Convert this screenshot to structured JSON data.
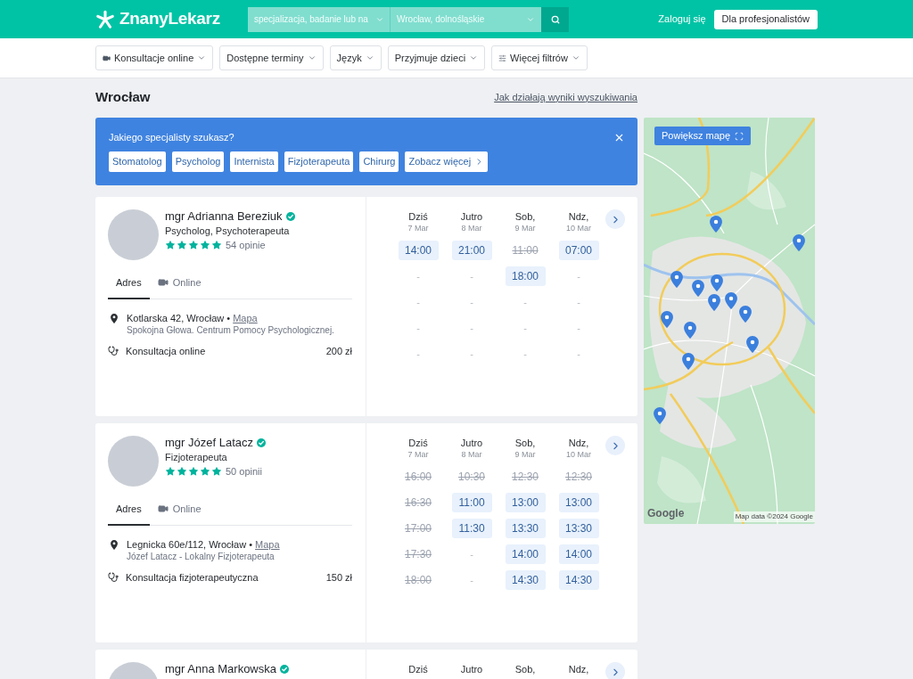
{
  "header": {
    "logo": "ZnanyLekarz",
    "search_fields": [
      {
        "placeholder": "specjalizacja, badanie lub na"
      },
      {
        "value": "Wrocław, dolnośląskie"
      }
    ],
    "login": "Zaloguj się",
    "pro_button": "Dla profesjonalistów"
  },
  "filters": [
    {
      "label": "Konsultacje online",
      "kind": "video"
    },
    {
      "label": "Dostępne terminy",
      "kind": "plain"
    },
    {
      "label": "Język",
      "kind": "plain"
    },
    {
      "label": "Przyjmuje dzieci",
      "kind": "plain"
    },
    {
      "label": "Więcej filtrów",
      "kind": "filter"
    }
  ],
  "results_header": {
    "title": "Wrocław",
    "help_link": "Jak działają wyniki wyszukiwania"
  },
  "specialist_prompt": {
    "title": "Jakiego specjalisty szukasz?",
    "chips": [
      {
        "label": "Stomatolog",
        "kind": "plain"
      },
      {
        "label": "Psycholog",
        "kind": "plain"
      },
      {
        "label": "Internista",
        "kind": "plain"
      },
      {
        "label": "Fizjoterapeuta",
        "kind": "plain"
      },
      {
        "label": "Chirurg",
        "kind": "plain"
      },
      {
        "label": "Zobacz więcej",
        "kind": "more"
      }
    ]
  },
  "doctors": [
    {
      "name": "mgr Adrianna Bereziuk",
      "verified": true,
      "specialties": "Psycholog, Psychoterapeuta",
      "stars": 5,
      "reviews": "54 opinie",
      "tabs": [
        {
          "label": "Adres",
          "kind": "plain",
          "selected": true
        },
        {
          "label": "Online",
          "kind": "video",
          "selected": false
        }
      ],
      "address": "Kotlarska 42, Wrocław •",
      "map_link": "Mapa",
      "clinic": "Spokojna Głowa. Centrum Pomocy Psychologicznej.",
      "service": "Konsultacja online",
      "price": "200 zł",
      "days": [
        {
          "day": "Dziś",
          "date": "7 Mar",
          "slots": [
            {
              "time": "14:00",
              "kind": "free"
            },
            {
              "time": "-",
              "kind": "none"
            },
            {
              "time": "-",
              "kind": "none"
            },
            {
              "time": "-",
              "kind": "none"
            },
            {
              "time": "-",
              "kind": "none"
            }
          ]
        },
        {
          "day": "Jutro",
          "date": "8 Mar",
          "slots": [
            {
              "time": "21:00",
              "kind": "free"
            },
            {
              "time": "-",
              "kind": "none"
            },
            {
              "time": "-",
              "kind": "none"
            },
            {
              "time": "-",
              "kind": "none"
            },
            {
              "time": "-",
              "kind": "none"
            }
          ]
        },
        {
          "day": "Sob,",
          "date": "9 Mar",
          "slots": [
            {
              "time": "11:00",
              "kind": "taken"
            },
            {
              "time": "18:00",
              "kind": "free"
            },
            {
              "time": "-",
              "kind": "none"
            },
            {
              "time": "-",
              "kind": "none"
            },
            {
              "time": "-",
              "kind": "none"
            }
          ]
        },
        {
          "day": "Ndz,",
          "date": "10 Mar",
          "slots": [
            {
              "time": "07:00",
              "kind": "free"
            },
            {
              "time": "-",
              "kind": "none"
            },
            {
              "time": "-",
              "kind": "none"
            },
            {
              "time": "-",
              "kind": "none"
            },
            {
              "time": "-",
              "kind": "none"
            }
          ]
        }
      ]
    },
    {
      "name": "mgr Józef Latacz",
      "verified": true,
      "specialties": "Fizjoterapeuta",
      "stars": 5,
      "reviews": "50 opinii",
      "tabs": [
        {
          "label": "Adres",
          "kind": "plain",
          "selected": true
        },
        {
          "label": "Online",
          "kind": "video",
          "selected": false
        }
      ],
      "address": "Legnicka 60e/112, Wrocław •",
      "map_link": "Mapa",
      "clinic": "Józef Latacz - Lokalny Fizjoterapeuta",
      "service": "Konsultacja fizjoterapeutyczna",
      "price": "150 zł",
      "days": [
        {
          "day": "Dziś",
          "date": "7 Mar",
          "slots": [
            {
              "time": "16:00",
              "kind": "taken"
            },
            {
              "time": "16:30",
              "kind": "taken"
            },
            {
              "time": "17:00",
              "kind": "taken"
            },
            {
              "time": "17:30",
              "kind": "taken"
            },
            {
              "time": "18:00",
              "kind": "taken"
            }
          ]
        },
        {
          "day": "Jutro",
          "date": "8 Mar",
          "slots": [
            {
              "time": "10:30",
              "kind": "taken"
            },
            {
              "time": "11:00",
              "kind": "free"
            },
            {
              "time": "11:30",
              "kind": "free"
            },
            {
              "time": "-",
              "kind": "none"
            },
            {
              "time": "-",
              "kind": "none"
            }
          ]
        },
        {
          "day": "Sob,",
          "date": "9 Mar",
          "slots": [
            {
              "time": "12:30",
              "kind": "taken"
            },
            {
              "time": "13:00",
              "kind": "free"
            },
            {
              "time": "13:30",
              "kind": "free"
            },
            {
              "time": "14:00",
              "kind": "free"
            },
            {
              "time": "14:30",
              "kind": "free"
            }
          ]
        },
        {
          "day": "Ndz,",
          "date": "10 Mar",
          "slots": [
            {
              "time": "12:30",
              "kind": "taken"
            },
            {
              "time": "13:00",
              "kind": "free"
            },
            {
              "time": "13:30",
              "kind": "free"
            },
            {
              "time": "14:00",
              "kind": "free"
            },
            {
              "time": "14:30",
              "kind": "free"
            }
          ]
        }
      ]
    },
    {
      "name": "mgr Anna Markowska",
      "verified": true,
      "days": [
        {
          "day": "Dziś"
        },
        {
          "day": "Jutro"
        },
        {
          "day": "Sob,"
        },
        {
          "day": "Ndz,"
        }
      ]
    }
  ],
  "map": {
    "button": "Powiększ mapę",
    "logo": "Google",
    "attribution": "Map data ©2024 Google"
  }
}
